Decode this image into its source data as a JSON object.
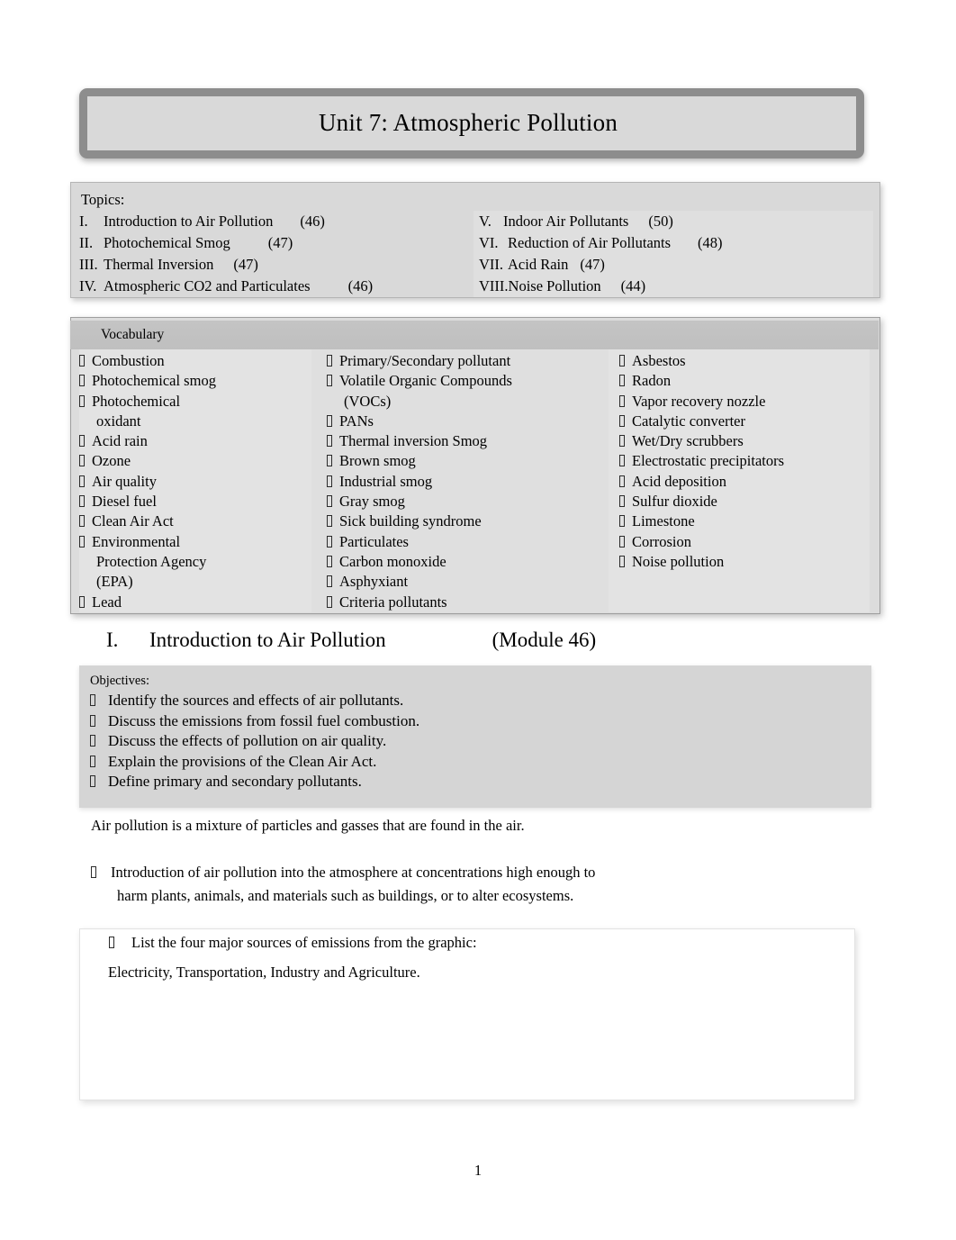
{
  "document": {
    "title": "Unit 7: Atmospheric Pollution",
    "page_number": "1"
  },
  "topics": {
    "label": "Topics:",
    "left": [
      {
        "numeral": "I.",
        "title": "Introduction to Air Pollution",
        "module": "(46)"
      },
      {
        "numeral": "II.",
        "title": "Photochemical Smog",
        "module": "(47)"
      },
      {
        "numeral": "III.",
        "title": "Thermal Inversion",
        "module": "(47)"
      },
      {
        "numeral": "IV.",
        "title": "Atmospheric CO2 and Particulates",
        "module": "(46)"
      }
    ],
    "right": [
      {
        "numeral": "V.",
        "title": "Indoor Air Pollutants",
        "module": "(50)"
      },
      {
        "numeral": "VI.",
        "title": "Reduction of Air Pollutants",
        "module": "(48)"
      },
      {
        "numeral": "VII.",
        "title": "Acid Rain",
        "module": "(47)"
      },
      {
        "numeral": "VIII.",
        "title": "Noise Pollution",
        "module": "(44)"
      }
    ]
  },
  "vocabulary": {
    "heading": "Vocabulary",
    "column1": [
      "Combustion",
      "Photochemical smog",
      "Photochemical",
      "oxidant",
      "Acid rain",
      "Ozone",
      "Air quality",
      "Diesel fuel",
      "Clean Air Act",
      "Environmental",
      "Protection Agency",
      "(EPA)",
      "Lead"
    ],
    "column1_continuations": [
      3,
      10,
      11
    ],
    "column2": [
      "Primary/Secondary pollutant",
      "Volatile Organic Compounds",
      "(VOCs)",
      "PANs",
      "Thermal inversion Smog",
      "Brown smog",
      "Industrial smog",
      "Gray smog",
      "Sick building syndrome",
      "Particulates",
      "Carbon monoxide",
      "Asphyxiant",
      "Criteria pollutants"
    ],
    "column2_continuations": [
      2
    ],
    "column3": [
      "Asbestos",
      "Radon",
      "Vapor recovery nozzle",
      "Catalytic converter",
      "Wet/Dry scrubbers",
      "Electrostatic precipitators",
      "Acid deposition",
      "Sulfur dioxide",
      "Limestone",
      "Corrosion",
      "Noise pollution"
    ],
    "column3_continuations": []
  },
  "section": {
    "numeral": "I.",
    "title": "Introduction to Air Pollution",
    "module": "(Module 46)"
  },
  "objectives": {
    "label": "Objectives:",
    "items": [
      "Identify the sources and effects of air pollutants.",
      "Discuss the emissions from fossil fuel combustion.",
      "Discuss the effects of pollution on air quality.",
      "Explain the provisions of the Clean Air Act.",
      "Define primary and secondary pollutants."
    ]
  },
  "body": {
    "definition_sentence": "Air pollution is a mixture of particles and gasses that are found in the air.",
    "bullet_line1": "Introduction of air pollution into the atmosphere at concentrations high enough to",
    "bullet_line2": "harm plants, animals, and materials such as buildings, or to alter ecosystems."
  },
  "answer_block": {
    "question": "List the four major sources of emissions from the graphic:",
    "answer": "Electricity, Transportation, Industry and Agriculture."
  },
  "icons": {
    "bullet": "missing-glyph-box"
  },
  "colors": {
    "page_background": "#ffffff",
    "banner_fill": "#d9d9d9",
    "banner_border": "#8d8d8d",
    "topics_fill": "#d9d9d9",
    "vocab_fill": "#dcdcdc",
    "vocab_header_fill": "#c2c2c2",
    "objectives_fill": "#d5d5d5",
    "answer_fill": "#ffffff",
    "text": "#000000"
  }
}
